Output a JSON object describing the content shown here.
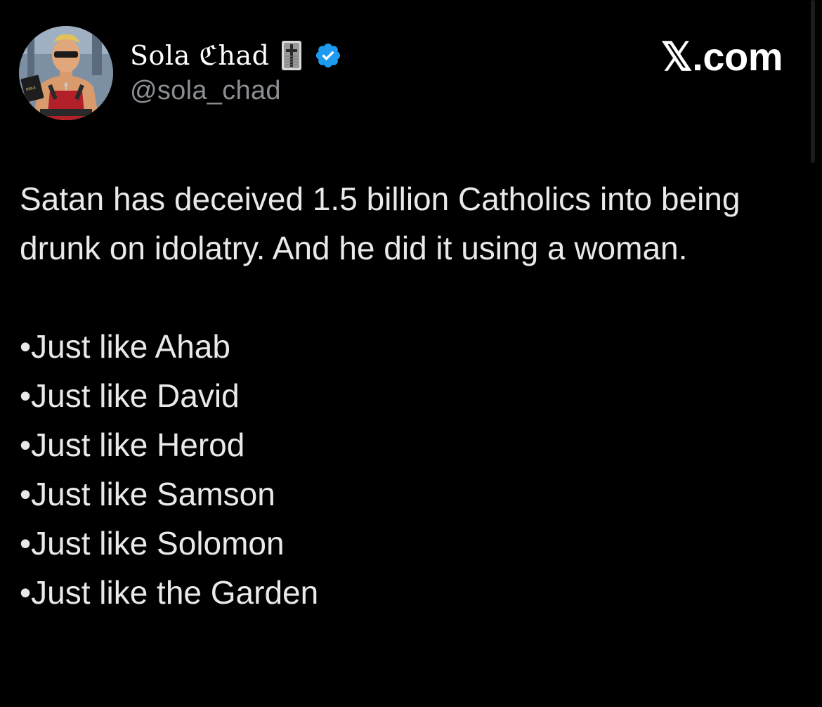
{
  "author": {
    "display_name": "Sola ℭhad",
    "handle": "@sola_chad",
    "avatar_icon": "avatar-image",
    "name_badge_icon": "cross-bookmark-icon",
    "verified_icon": "verified-badge-icon"
  },
  "brand": {
    "label": "𝕏.com"
  },
  "tweet": {
    "lead": "Satan has deceived 1.5 billion Catholics into being drunk on idolatry. And he did it using a woman.",
    "bullets": [
      "•Just like Ahab",
      "•Just like David",
      "•Just like Herod",
      "•Just like Samson",
      "•Just like Solomon",
      "•Just like the Garden"
    ]
  },
  "colors": {
    "background": "#000000",
    "text": "#e7e9ea",
    "muted": "#8b8f94",
    "verified": "#1d9bf0"
  }
}
